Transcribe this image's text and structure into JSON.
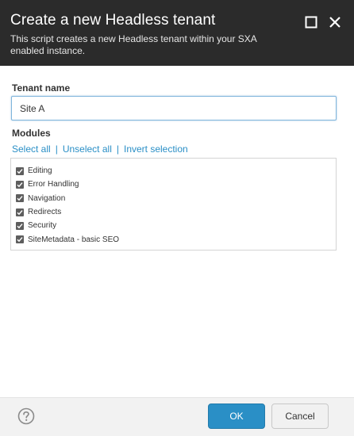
{
  "dialog": {
    "title": "Create a new Headless tenant",
    "subtitle": "This script creates a new Headless tenant within your SXA enabled instance.",
    "maximize_icon": "maximize-icon",
    "close_icon": "close-icon"
  },
  "form": {
    "tenant_label": "Tenant name",
    "tenant_value": "Site A",
    "modules_label": "Modules",
    "select_all": "Select all",
    "separator": "|",
    "unselect_all": "Unselect all",
    "invert_selection": "Invert selection",
    "modules": [
      {
        "label": "Editing",
        "checked": true
      },
      {
        "label": "Error Handling",
        "checked": true
      },
      {
        "label": "Navigation",
        "checked": true
      },
      {
        "label": "Redirects",
        "checked": true
      },
      {
        "label": "Security",
        "checked": true
      },
      {
        "label": "SiteMetadata - basic SEO",
        "checked": true
      }
    ]
  },
  "footer": {
    "help_icon": "help-icon",
    "ok_label": "OK",
    "cancel_label": "Cancel"
  },
  "colors": {
    "title_bar": "#2b2b2b",
    "accent": "#2a8fc6",
    "footer_bg": "#f2f2f2"
  }
}
